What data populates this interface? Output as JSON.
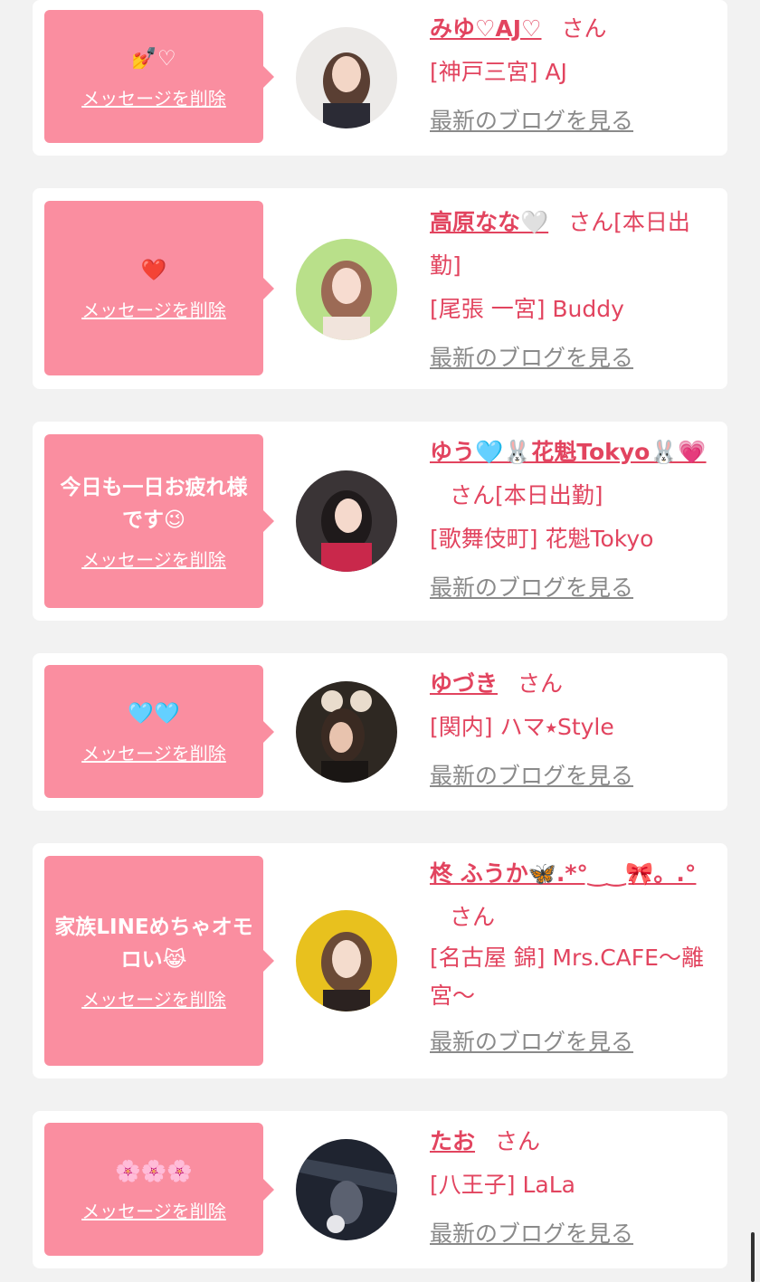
{
  "common": {
    "delete_label": "メッセージを削除",
    "blog_label": "最新のブログを見る",
    "san_label": "さん"
  },
  "cards": [
    {
      "message": "💅♡",
      "name": "みゆ♡AJ♡",
      "tag": "",
      "area_shop": "[神戸三宮] AJ"
    },
    {
      "message": "❤️",
      "name": "高原なな🤍",
      "tag": "[本日出勤]",
      "area_shop": "[尾張 一宮] Buddy"
    },
    {
      "message": "今日も一日お疲れ様です😉",
      "name": "ゆう🩵🐰花魁Tokyo🐰💗",
      "tag": "[本日出勤]",
      "area_shop": "[歌舞伎町] 花魁Tokyo"
    },
    {
      "message": "🩵🩵",
      "name": "ゆづき",
      "tag": "",
      "area_shop": "[関内] ハマ⭑Style"
    },
    {
      "message": "家族LINEめちゃオモロい😹",
      "name": "柊 ふうか🦋.*°‿‿🎀。.°",
      "tag": "",
      "area_shop": "[名古屋 錦] Mrs.CAFE〜離宮〜"
    },
    {
      "message": "🌸🌸🌸",
      "name": "たお",
      "tag": "",
      "area_shop": "[八王子] LaLa"
    }
  ],
  "colors": {
    "accent": "#e2445f",
    "bubble": "#fa8ea0",
    "background": "#f2f2f2"
  }
}
